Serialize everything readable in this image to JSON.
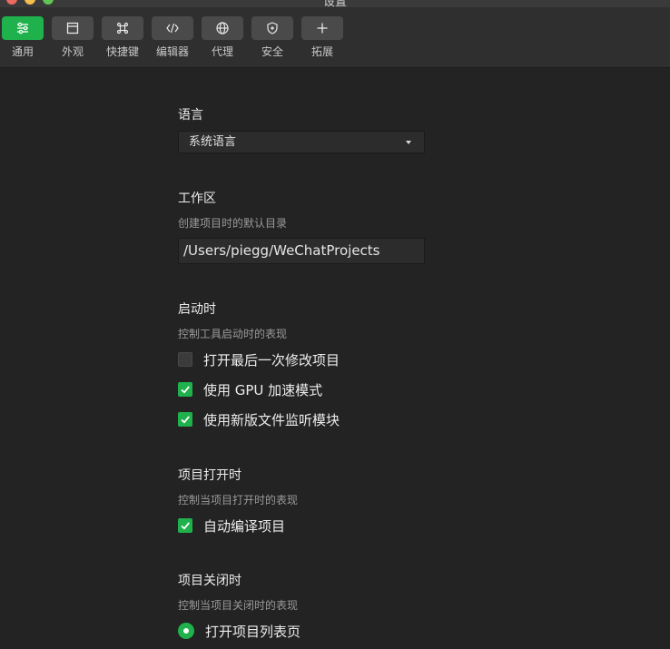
{
  "window": {
    "title": "设置"
  },
  "toolbar": [
    {
      "label": "通用",
      "icon": "sliders-icon",
      "active": true
    },
    {
      "label": "外观",
      "icon": "layout-icon",
      "active": false
    },
    {
      "label": "快捷键",
      "icon": "command-key-icon",
      "active": false
    },
    {
      "label": "编辑器",
      "icon": "code-icon",
      "active": false
    },
    {
      "label": "代理",
      "icon": "globe-icon",
      "active": false
    },
    {
      "label": "安全",
      "icon": "shield-icon",
      "active": false
    },
    {
      "label": "拓展",
      "icon": "plus-icon",
      "active": false
    }
  ],
  "language": {
    "title": "语言",
    "value": "系统语言"
  },
  "workspace": {
    "title": "工作区",
    "desc": "创建项目时的默认目录",
    "path": "/Users/piegg/WeChatProjects"
  },
  "startup": {
    "title": "启动时",
    "desc": "控制工具启动时的表现",
    "options": [
      {
        "label": "打开最后一次修改项目",
        "checked": false
      },
      {
        "label": "使用 GPU 加速模式",
        "checked": true
      },
      {
        "label": "使用新版文件监听模块",
        "checked": true
      }
    ]
  },
  "project_open": {
    "title": "项目打开时",
    "desc": "控制当项目打开时的表现",
    "options": [
      {
        "label": "自动编译项目",
        "checked": true
      }
    ]
  },
  "project_close": {
    "title": "项目关闭时",
    "desc": "控制当项目关闭时的表现",
    "options": [
      {
        "label": "打开项目列表页",
        "selected": true
      }
    ]
  },
  "colors": {
    "accent": "#1fb14c",
    "background": "#232323",
    "toolbar": "#2f2f2f"
  }
}
